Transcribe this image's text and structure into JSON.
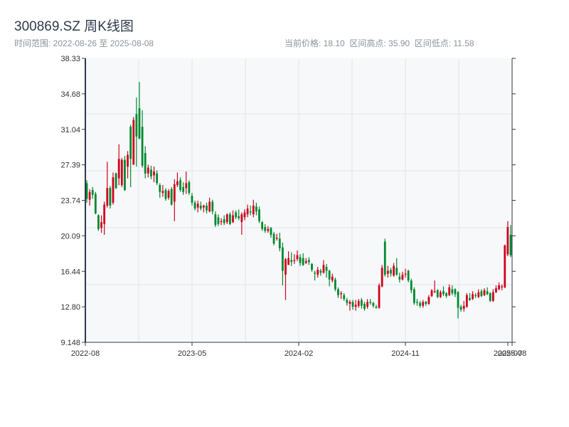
{
  "header": {
    "title": "300869.SZ 周K线图",
    "range": "时间范围: 2022-08-26 至 2025-08-08",
    "stats": "当前价格: 18.10  区间高点: 35.90  区间低点: 11.58"
  },
  "colors": {
    "up": "#d0021b",
    "down": "#00892f",
    "plot_bg": "#f6f8fa",
    "grid": "#e2e5ea",
    "axis": "#2d3a4b"
  },
  "chart_data": {
    "type": "candlestick",
    "title": "300869.SZ 周K线图",
    "ylim": [
      9.148,
      38.33
    ],
    "yticks": [
      "38.33",
      "34.68",
      "31.04",
      "27.39",
      "23.74",
      "20.09",
      "16.44",
      "12.80",
      "9.148"
    ],
    "xticks": [
      "2022-08",
      "2023-05",
      "2024-02",
      "2024-11",
      "2025-07",
      "2025-08"
    ],
    "xtick_positions": [
      0,
      0.25,
      0.5,
      0.75,
      0.99,
      1.0
    ],
    "grid": true,
    "ohlc": [
      [
        25.5,
        25.8,
        23.5,
        23.9
      ],
      [
        23.8,
        24.9,
        23.2,
        24.6
      ],
      [
        24.8,
        25.1,
        23.9,
        24.3
      ],
      [
        24.4,
        24.6,
        22.3,
        22.4
      ],
      [
        22.2,
        22.3,
        20.6,
        20.8
      ],
      [
        20.9,
        22.2,
        20.4,
        21.5
      ],
      [
        21.3,
        23.6,
        20.2,
        23.3
      ],
      [
        23.2,
        27.7,
        23.0,
        25.0
      ],
      [
        25.0,
        25.2,
        22.9,
        23.2
      ],
      [
        23.5,
        26.6,
        23.3,
        26.1
      ],
      [
        26.5,
        26.6,
        24.9,
        25.0
      ],
      [
        26.0,
        29.5,
        25.3,
        28.0
      ],
      [
        25.3,
        28.1,
        25.1,
        27.9
      ],
      [
        27.9,
        28.3,
        24.7,
        24.8
      ],
      [
        27.2,
        28.8,
        26.0,
        28.4
      ],
      [
        31.3,
        31.5,
        25.1,
        28.0
      ],
      [
        27.4,
        32.3,
        27.4,
        32.0
      ],
      [
        32.6,
        34.3,
        27.2,
        30.3
      ],
      [
        33.2,
        35.9,
        30.0,
        30.1
      ],
      [
        31.3,
        33.0,
        27.1,
        27.3
      ],
      [
        28.6,
        29.3,
        26.0,
        26.5
      ],
      [
        26.5,
        27.4,
        26.1,
        27.1
      ],
      [
        26.9,
        27.3,
        25.9,
        26.2
      ],
      [
        26.3,
        27.2,
        25.6,
        26.7
      ],
      [
        26.5,
        26.8,
        25.3,
        25.5
      ],
      [
        25.3,
        25.5,
        24.0,
        24.6
      ],
      [
        24.5,
        25.3,
        24.1,
        24.7
      ],
      [
        24.8,
        25.0,
        23.7,
        23.9
      ],
      [
        24.0,
        24.9,
        23.8,
        24.7
      ],
      [
        24.9,
        25.1,
        23.2,
        23.3
      ],
      [
        23.6,
        25.9,
        21.6,
        25.4
      ],
      [
        25.3,
        26.6,
        25.1,
        25.7
      ],
      [
        25.8,
        26.1,
        24.6,
        24.8
      ],
      [
        25.1,
        25.6,
        24.3,
        24.6
      ],
      [
        25.0,
        26.7,
        24.4,
        25.5
      ],
      [
        25.6,
        25.8,
        24.3,
        24.5
      ],
      [
        24.2,
        24.5,
        23.2,
        23.5
      ],
      [
        23.5,
        23.7,
        22.7,
        22.9
      ],
      [
        23.0,
        23.7,
        22.5,
        23.4
      ],
      [
        23.2,
        23.6,
        22.7,
        22.9
      ],
      [
        23.0,
        23.3,
        22.5,
        23.2
      ],
      [
        23.2,
        23.5,
        22.4,
        22.7
      ],
      [
        22.6,
        24.0,
        22.5,
        23.6
      ],
      [
        23.6,
        23.8,
        22.3,
        22.6
      ],
      [
        22.3,
        22.6,
        21.0,
        21.2
      ],
      [
        22.0,
        22.3,
        21.1,
        21.3
      ],
      [
        21.5,
        21.9,
        21.2,
        21.6
      ],
      [
        21.8,
        22.2,
        21.2,
        21.4
      ],
      [
        21.5,
        22.4,
        21.3,
        22.3
      ],
      [
        22.3,
        22.5,
        21.2,
        21.3
      ],
      [
        21.5,
        22.7,
        21.4,
        22.2
      ],
      [
        22.5,
        22.7,
        21.8,
        22.0
      ],
      [
        22.1,
        22.8,
        21.7,
        21.9
      ],
      [
        21.5,
        22.5,
        20.2,
        22.3
      ],
      [
        22.0,
        22.8,
        21.7,
        22.5
      ],
      [
        22.3,
        23.3,
        22.0,
        22.9
      ],
      [
        22.6,
        23.2,
        22.2,
        22.5
      ],
      [
        22.3,
        23.8,
        22.0,
        23.2
      ],
      [
        23.1,
        23.5,
        22.2,
        22.6
      ],
      [
        22.8,
        23.1,
        21.4,
        21.6
      ],
      [
        21.5,
        21.6,
        20.6,
        20.8
      ],
      [
        21.0,
        21.3,
        20.4,
        20.6
      ],
      [
        20.6,
        21.1,
        20.4,
        20.8
      ],
      [
        20.9,
        21.0,
        19.9,
        20.2
      ],
      [
        20.3,
        20.5,
        19.1,
        19.3
      ],
      [
        19.8,
        20.3,
        19.6,
        19.9
      ],
      [
        19.8,
        20.4,
        18.5,
        18.8
      ],
      [
        18.9,
        19.4,
        15.0,
        16.5
      ],
      [
        16.1,
        17.8,
        13.5,
        17.7
      ],
      [
        17.1,
        18.5,
        17.4,
        17.8
      ],
      [
        17.6,
        18.4,
        17.0,
        17.4
      ],
      [
        17.5,
        18.2,
        17.2,
        17.6
      ],
      [
        17.7,
        18.6,
        17.5,
        18.1
      ],
      [
        17.9,
        18.2,
        17.0,
        17.3
      ],
      [
        17.8,
        18.3,
        17.0,
        17.1
      ],
      [
        17.3,
        17.8,
        17.2,
        17.5
      ],
      [
        17.6,
        17.9,
        17.1,
        17.4
      ],
      [
        17.2,
        17.3,
        16.4,
        16.6
      ],
      [
        16.3,
        16.5,
        15.5,
        16.2
      ],
      [
        16.1,
        16.9,
        15.8,
        16.6
      ],
      [
        16.5,
        16.7,
        16.0,
        16.3
      ],
      [
        16.3,
        17.6,
        16.2,
        17.1
      ],
      [
        16.9,
        17.2,
        15.8,
        16.5
      ],
      [
        16.5,
        16.6,
        14.9,
        15.6
      ],
      [
        15.5,
        16.2,
        15.3,
        15.9
      ],
      [
        15.6,
        15.8,
        14.4,
        14.6
      ],
      [
        14.6,
        14.8,
        13.7,
        14.0
      ],
      [
        14.1,
        14.4,
        13.6,
        14.2
      ],
      [
        14.0,
        14.2,
        13.4,
        13.6
      ],
      [
        13.5,
        13.7,
        12.9,
        13.2
      ],
      [
        13.1,
        13.5,
        12.4,
        13.3
      ],
      [
        13.3,
        13.5,
        12.5,
        12.8
      ],
      [
        12.8,
        13.5,
        12.4,
        13.0
      ],
      [
        12.9,
        13.6,
        12.7,
        13.4
      ],
      [
        13.5,
        13.7,
        12.6,
        12.9
      ],
      [
        13.1,
        13.3,
        12.4,
        12.6
      ],
      [
        12.8,
        13.6,
        12.6,
        13.3
      ],
      [
        13.3,
        13.6,
        13.0,
        13.2
      ],
      [
        13.2,
        13.3,
        12.7,
        12.9
      ],
      [
        12.8,
        13.0,
        12.6,
        12.7
      ],
      [
        12.7,
        15.2,
        12.6,
        15.0
      ],
      [
        14.9,
        17.1,
        14.8,
        16.8
      ],
      [
        19.5,
        19.8,
        15.9,
        16.1
      ],
      [
        16.2,
        17.0,
        15.8,
        16.5
      ],
      [
        16.6,
        16.8,
        15.9,
        16.2
      ],
      [
        16.0,
        17.3,
        15.9,
        17.0
      ],
      [
        16.8,
        17.8,
        16.0,
        16.1
      ],
      [
        15.9,
        16.3,
        15.3,
        15.6
      ],
      [
        15.6,
        16.4,
        15.5,
        16.1
      ],
      [
        16.1,
        16.7,
        15.8,
        16.2
      ],
      [
        16.5,
        16.6,
        15.3,
        15.5
      ],
      [
        15.5,
        15.7,
        14.2,
        14.5
      ],
      [
        14.6,
        14.8,
        13.0,
        13.2
      ],
      [
        13.3,
        13.6,
        12.9,
        13.2
      ],
      [
        13.2,
        13.4,
        12.7,
        12.9
      ],
      [
        12.9,
        13.5,
        12.7,
        13.3
      ],
      [
        13.3,
        13.4,
        12.9,
        13.1
      ],
      [
        13.1,
        14.0,
        13.0,
        13.8
      ],
      [
        13.9,
        14.6,
        13.8,
        14.5
      ],
      [
        14.3,
        15.5,
        14.2,
        14.4
      ],
      [
        14.5,
        14.6,
        13.7,
        13.8
      ],
      [
        13.8,
        14.5,
        13.7,
        14.3
      ],
      [
        14.4,
        14.9,
        13.9,
        14.1
      ],
      [
        14.2,
        14.3,
        13.7,
        13.9
      ],
      [
        14.0,
        15.1,
        13.9,
        14.8
      ],
      [
        14.6,
        15.0,
        14.0,
        14.2
      ],
      [
        14.6,
        14.7,
        13.8,
        14.1
      ],
      [
        14.3,
        14.4,
        11.6,
        12.7
      ],
      [
        12.8,
        13.0,
        12.3,
        12.5
      ],
      [
        12.6,
        13.4,
        12.3,
        12.9
      ],
      [
        12.8,
        14.2,
        12.7,
        14.0
      ],
      [
        13.7,
        14.2,
        13.4,
        13.5
      ],
      [
        13.6,
        14.4,
        13.5,
        14.1
      ],
      [
        14.0,
        14.2,
        13.7,
        13.9
      ],
      [
        13.8,
        14.6,
        13.7,
        14.3
      ],
      [
        14.4,
        14.6,
        13.8,
        13.9
      ],
      [
        14.0,
        14.7,
        13.9,
        14.5
      ],
      [
        14.4,
        14.8,
        14.0,
        14.1
      ],
      [
        14.2,
        14.3,
        13.3,
        13.4
      ],
      [
        13.4,
        14.6,
        13.3,
        14.3
      ],
      [
        14.3,
        15.0,
        14.2,
        14.7
      ],
      [
        14.6,
        15.3,
        14.5,
        15.0
      ],
      [
        14.8,
        15.1,
        14.5,
        14.9
      ],
      [
        14.8,
        19.2,
        14.7,
        19.1
      ],
      [
        18.2,
        21.6,
        18.0,
        21.0
      ],
      [
        20.2,
        21.2,
        17.9,
        18.1
      ]
    ]
  }
}
